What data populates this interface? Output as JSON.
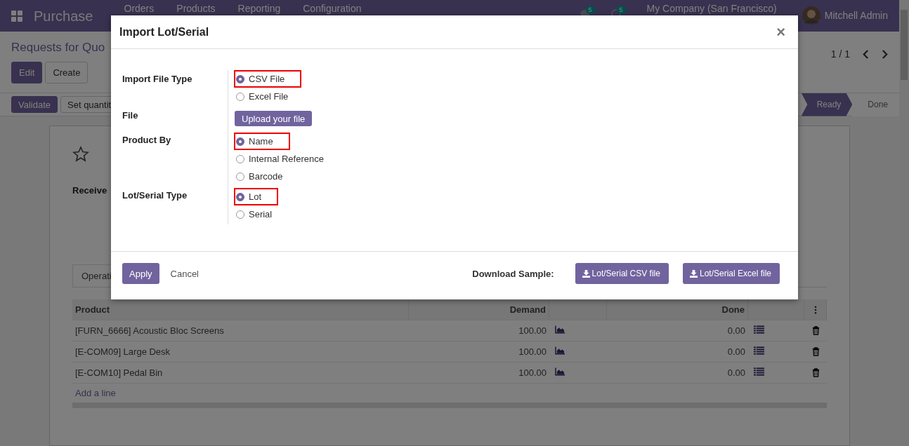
{
  "navbar": {
    "app_name": "Purchase",
    "menu": [
      "Orders",
      "Products",
      "Reporting",
      "Configuration"
    ],
    "badges": [
      "5",
      "5"
    ],
    "company": "My Company (San Francisco)",
    "user": "Mitchell Admin"
  },
  "control_panel": {
    "breadcrumb": "Requests for Quo",
    "buttons": [
      {
        "label": "Edit",
        "kind": "primary"
      },
      {
        "label": "Create",
        "kind": "secondary"
      }
    ],
    "pager": "1 / 1"
  },
  "status_bar": {
    "actions": [
      {
        "label": "Validate",
        "kind": "primary"
      },
      {
        "label": "Set quantit",
        "kind": "secondary"
      }
    ],
    "stages": [
      {
        "label": "Ready",
        "selected": true
      },
      {
        "label": "Done",
        "selected": false
      }
    ]
  },
  "form": {
    "field_label": "Receive",
    "tab": "Operati"
  },
  "table": {
    "columns": [
      "Product",
      "Demand",
      "Done"
    ],
    "rows": [
      {
        "product": "[FURN_6666] Acoustic Bloc Screens",
        "demand": "100.00",
        "done": "0.00"
      },
      {
        "product": "[E-COM09] Large Desk",
        "demand": "100.00",
        "done": "0.00"
      },
      {
        "product": "[E-COM10] Pedal Bin",
        "demand": "100.00",
        "done": "0.00"
      }
    ],
    "add_line": "Add a line"
  },
  "dialog": {
    "title": "Import Lot/Serial",
    "close": "×",
    "fields": [
      {
        "label": "Import File Type",
        "kind": "radio",
        "options": [
          {
            "label": "CSV File",
            "selected": true
          },
          {
            "label": "Excel File",
            "selected": false
          }
        ]
      },
      {
        "label": "File",
        "kind": "upload",
        "button": "Upload your file"
      },
      {
        "label": "Product By",
        "kind": "radio",
        "options": [
          {
            "label": "Name",
            "selected": true
          },
          {
            "label": "Internal Reference",
            "selected": false
          },
          {
            "label": "Barcode",
            "selected": false
          }
        ]
      },
      {
        "label": "Lot/Serial Type",
        "kind": "radio",
        "options": [
          {
            "label": "Lot",
            "selected": true
          },
          {
            "label": "Serial",
            "selected": false
          }
        ]
      }
    ],
    "apply": "Apply",
    "cancel": "Cancel",
    "download_label": "Download Sample:",
    "downloads": [
      "Lot/Serial CSV file",
      "Lot/Serial Excel file"
    ]
  }
}
